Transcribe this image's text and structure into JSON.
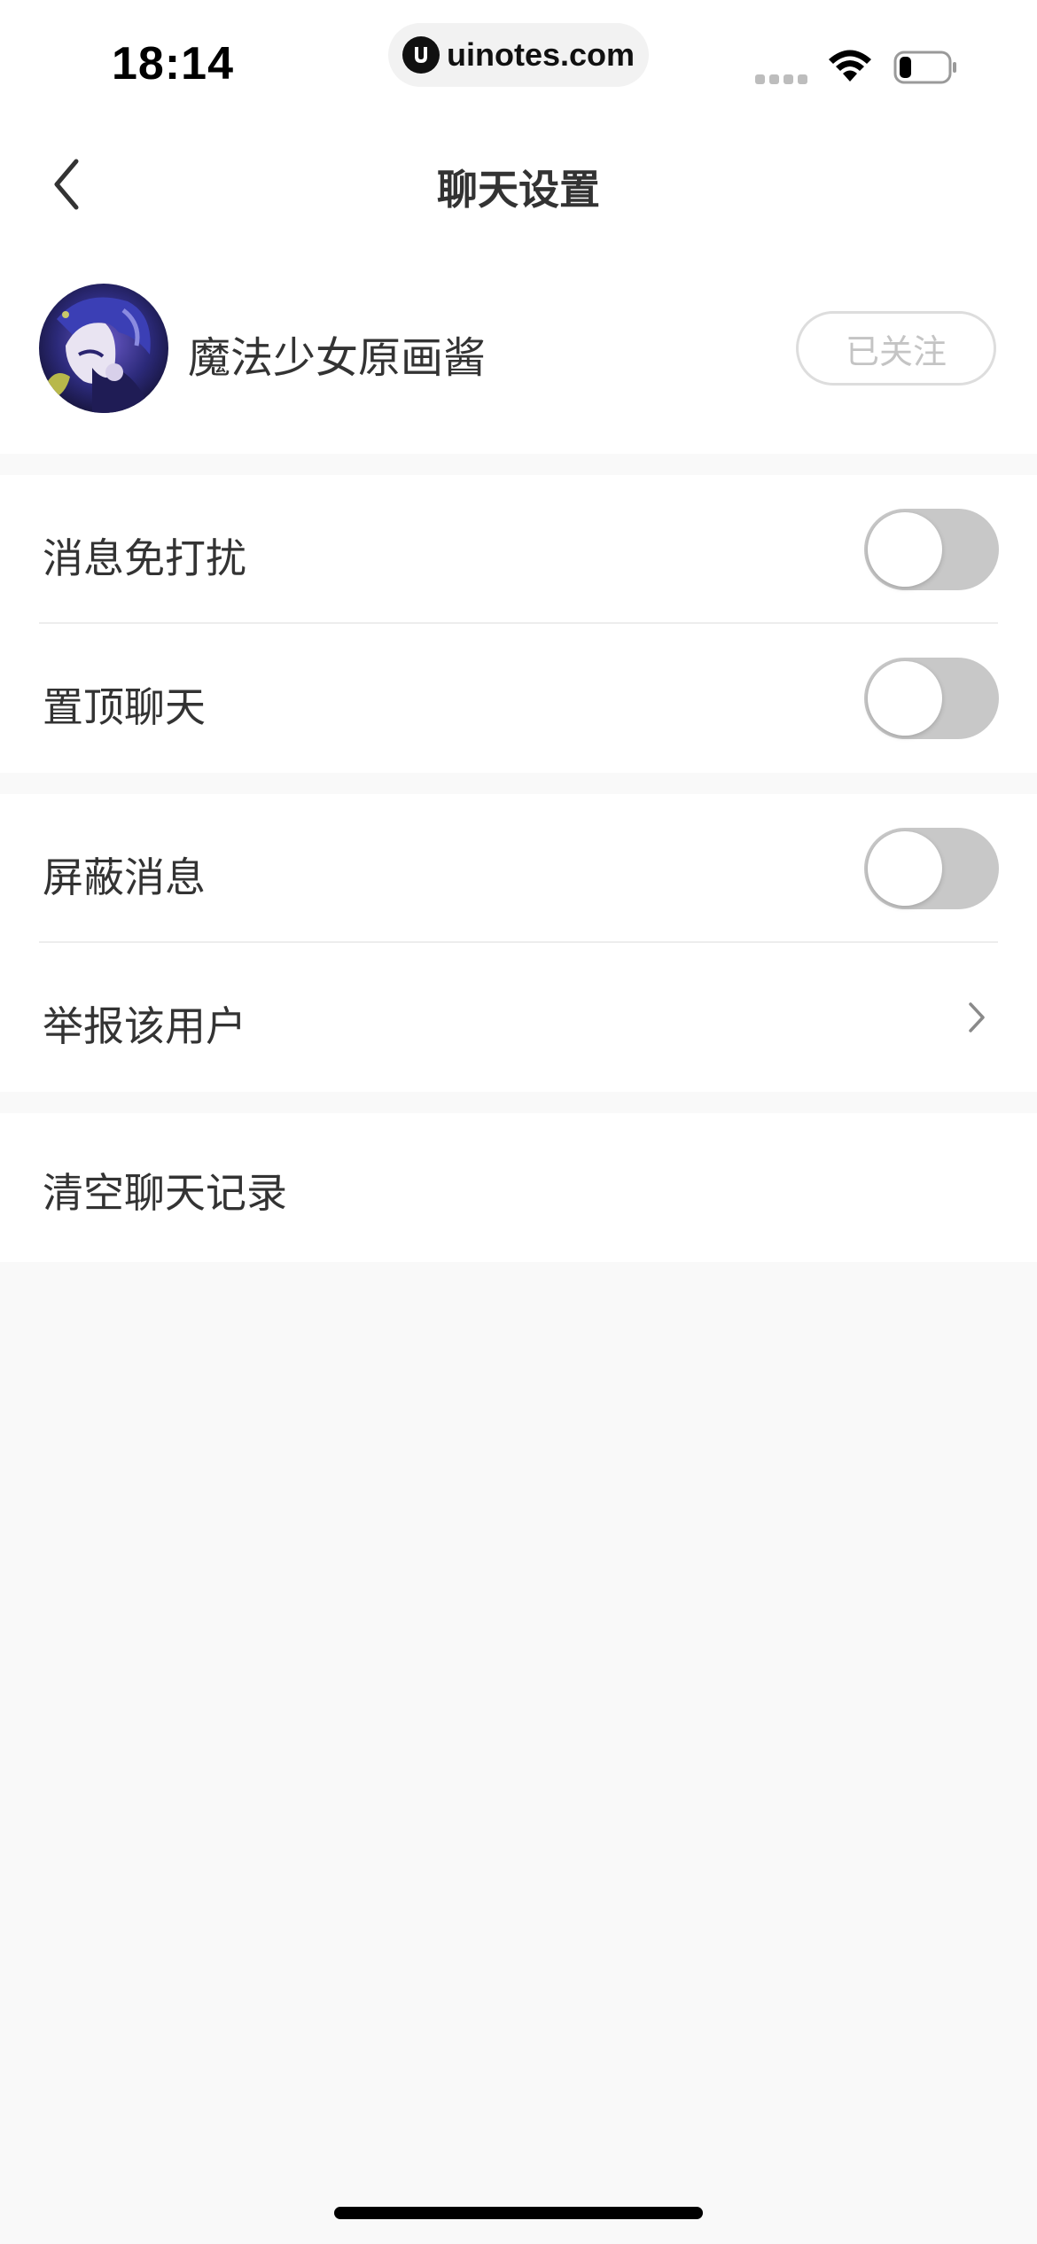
{
  "status_bar": {
    "time": "18:14",
    "url": "uinotes.com",
    "icons": [
      "signal-icon",
      "wifi-icon",
      "battery-icon"
    ],
    "battery_level": 0.25
  },
  "nav": {
    "title": "聊天设置",
    "back_icon": "chevron-left-icon"
  },
  "profile": {
    "name": "魔法少女原画酱",
    "follow_label": "已关注"
  },
  "settings": {
    "group1": [
      {
        "label": "消息免打扰",
        "control": "toggle",
        "on": false
      },
      {
        "label": "置顶聊天",
        "control": "toggle",
        "on": false
      }
    ],
    "group2": [
      {
        "label": "屏蔽消息",
        "control": "toggle",
        "on": false
      },
      {
        "label": "举报该用户",
        "control": "chevron"
      }
    ],
    "group3": [
      {
        "label": "清空聊天记录",
        "control": "none"
      }
    ]
  },
  "colors": {
    "background": "#f9f9f9",
    "surface": "#ffffff",
    "text": "#333333",
    "toggle_off": "#c8c8c8",
    "follow_border": "#dddddd",
    "follow_text": "#c4c4c4"
  }
}
